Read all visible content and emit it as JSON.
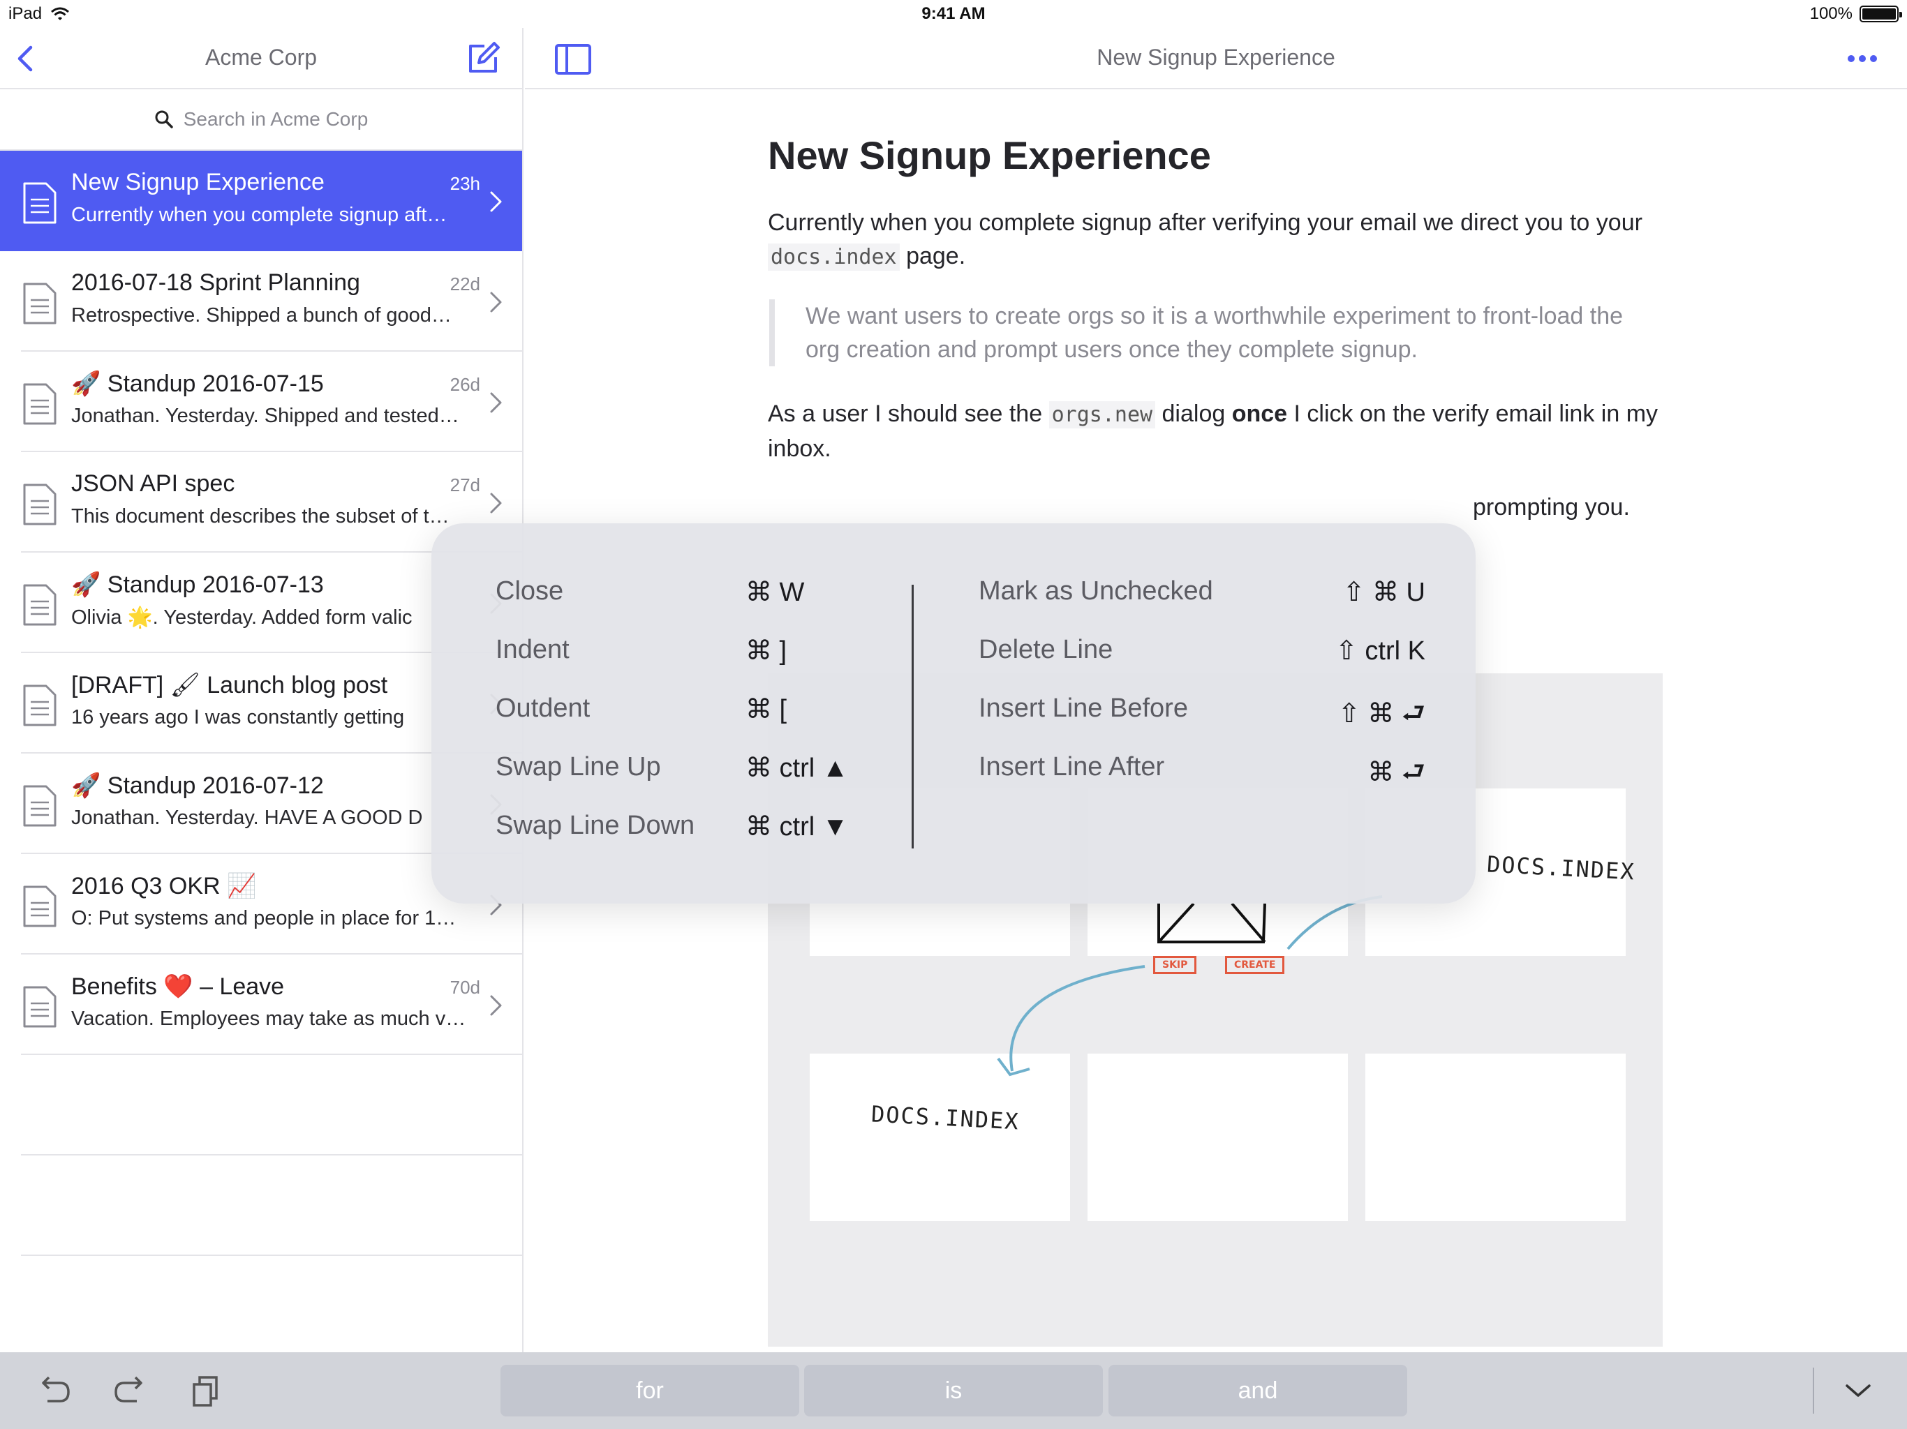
{
  "status_bar": {
    "device": "iPad",
    "time": "9:41 AM",
    "battery": "100%",
    "battery_level": 1.0
  },
  "sidebar": {
    "title": "Acme Corp",
    "search_placeholder": "Search in Acme Corp",
    "documents": [
      {
        "title": "New Signup Experience",
        "snippet": "Currently when you complete signup aft…",
        "age": "23h",
        "selected": true
      },
      {
        "title": "2016-07-18 Sprint Planning",
        "snippet": "Retrospective. Shipped a bunch of good…",
        "age": "22d"
      },
      {
        "title": "🚀 Standup 2016-07-15",
        "snippet": "Jonathan. Yesterday. Shipped and tested…",
        "age": "26d"
      },
      {
        "title": "JSON API spec",
        "snippet": "This document describes the subset of t…",
        "age": "27d"
      },
      {
        "title": "🚀 Standup 2016-07-13",
        "snippet": "Olivia 🌟. Yesterday. Added form valic",
        "age": ""
      },
      {
        "title": "[DRAFT] 🖌 Launch blog post",
        "snippet": "16 years ago I was constantly getting",
        "age": ""
      },
      {
        "title": "🚀 Standup 2016-07-12",
        "snippet": "Jonathan. Yesterday. HAVE A GOOD D",
        "age": ""
      },
      {
        "title": "2016 Q3 OKR 📈",
        "snippet": "O: Put systems and people in place for 1…",
        "age": ""
      },
      {
        "title": "Benefits ❤️ – Leave",
        "snippet": "Vacation. Employees may take as much v…",
        "age": "70d"
      }
    ]
  },
  "main": {
    "header_title": "New Signup Experience",
    "doc_title": "New Signup Experience",
    "p1_before": "Currently when you complete signup after verifying your email we direct you to your ",
    "p1_code": "docs.index",
    "p1_after": " page.",
    "quote": "We want users to create orgs so it is a worthwhile experiment to front-load the org creation and prompt users once they complete signup.",
    "p2_a": "As a user I should see the ",
    "p2_code": "orgs.new",
    "p2_b": " dialog ",
    "p2_bold": "once",
    "p2_c": " I click on the verify email link in my inbox.",
    "p3_visible": "prompting you.",
    "sketch": {
      "label_top": "DOCS.INDEX",
      "label_bottom": "DOCS.INDEX",
      "btn_skip": "SKIP",
      "btn_create": "CREATE"
    }
  },
  "shortcuts": {
    "left": [
      {
        "name": "Close",
        "keys": "⌘ W"
      },
      {
        "name": "Indent",
        "keys": "⌘ ]"
      },
      {
        "name": "Outdent",
        "keys": "⌘ ["
      },
      {
        "name": "Swap Line Up",
        "keys": "⌘ ctrl ▲"
      },
      {
        "name": "Swap Line Down",
        "keys": "⌘ ctrl ▼"
      }
    ],
    "right": [
      {
        "name": "Mark as Unchecked",
        "keys": "⇧ ⌘ U"
      },
      {
        "name": "Delete Line",
        "keys": "⇧ ctrl K"
      },
      {
        "name": "Insert Line Before",
        "keys": "⇧ ⌘ ⮐"
      },
      {
        "name": "Insert Line After",
        "keys": "⌘ ⮐"
      }
    ]
  },
  "keyboard": {
    "suggestions": [
      "for",
      "is",
      "and"
    ],
    "icons": [
      "undo-icon",
      "redo-icon",
      "paste-icon",
      "hide-keyboard-icon"
    ]
  },
  "colors": {
    "accent": "#4f5bf2",
    "selected_row": "#4f5bf2",
    "sketch_orange": "#e2583e",
    "sketch_arrow": "#6fb0cc"
  }
}
